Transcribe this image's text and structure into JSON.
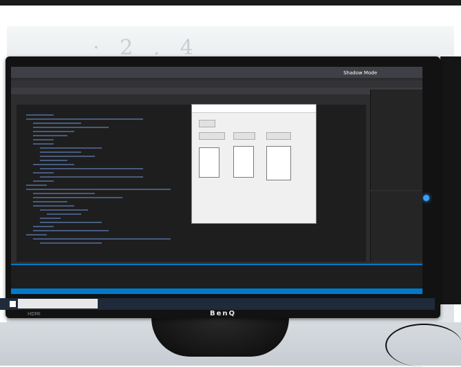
{
  "monitor": {
    "brand": "BenQ",
    "bottom_left_label": "HDMI",
    "screen": {
      "titlebar_label": "Shadow Mode"
    }
  },
  "colors": {
    "ide_background": "#2d2d30",
    "editor_background": "#1e1e1e",
    "accent_blue": "#007acc",
    "form_background": "#f0f0f0"
  },
  "icons": [
    "windows-start-icon",
    "blue-power-led-icon"
  ]
}
